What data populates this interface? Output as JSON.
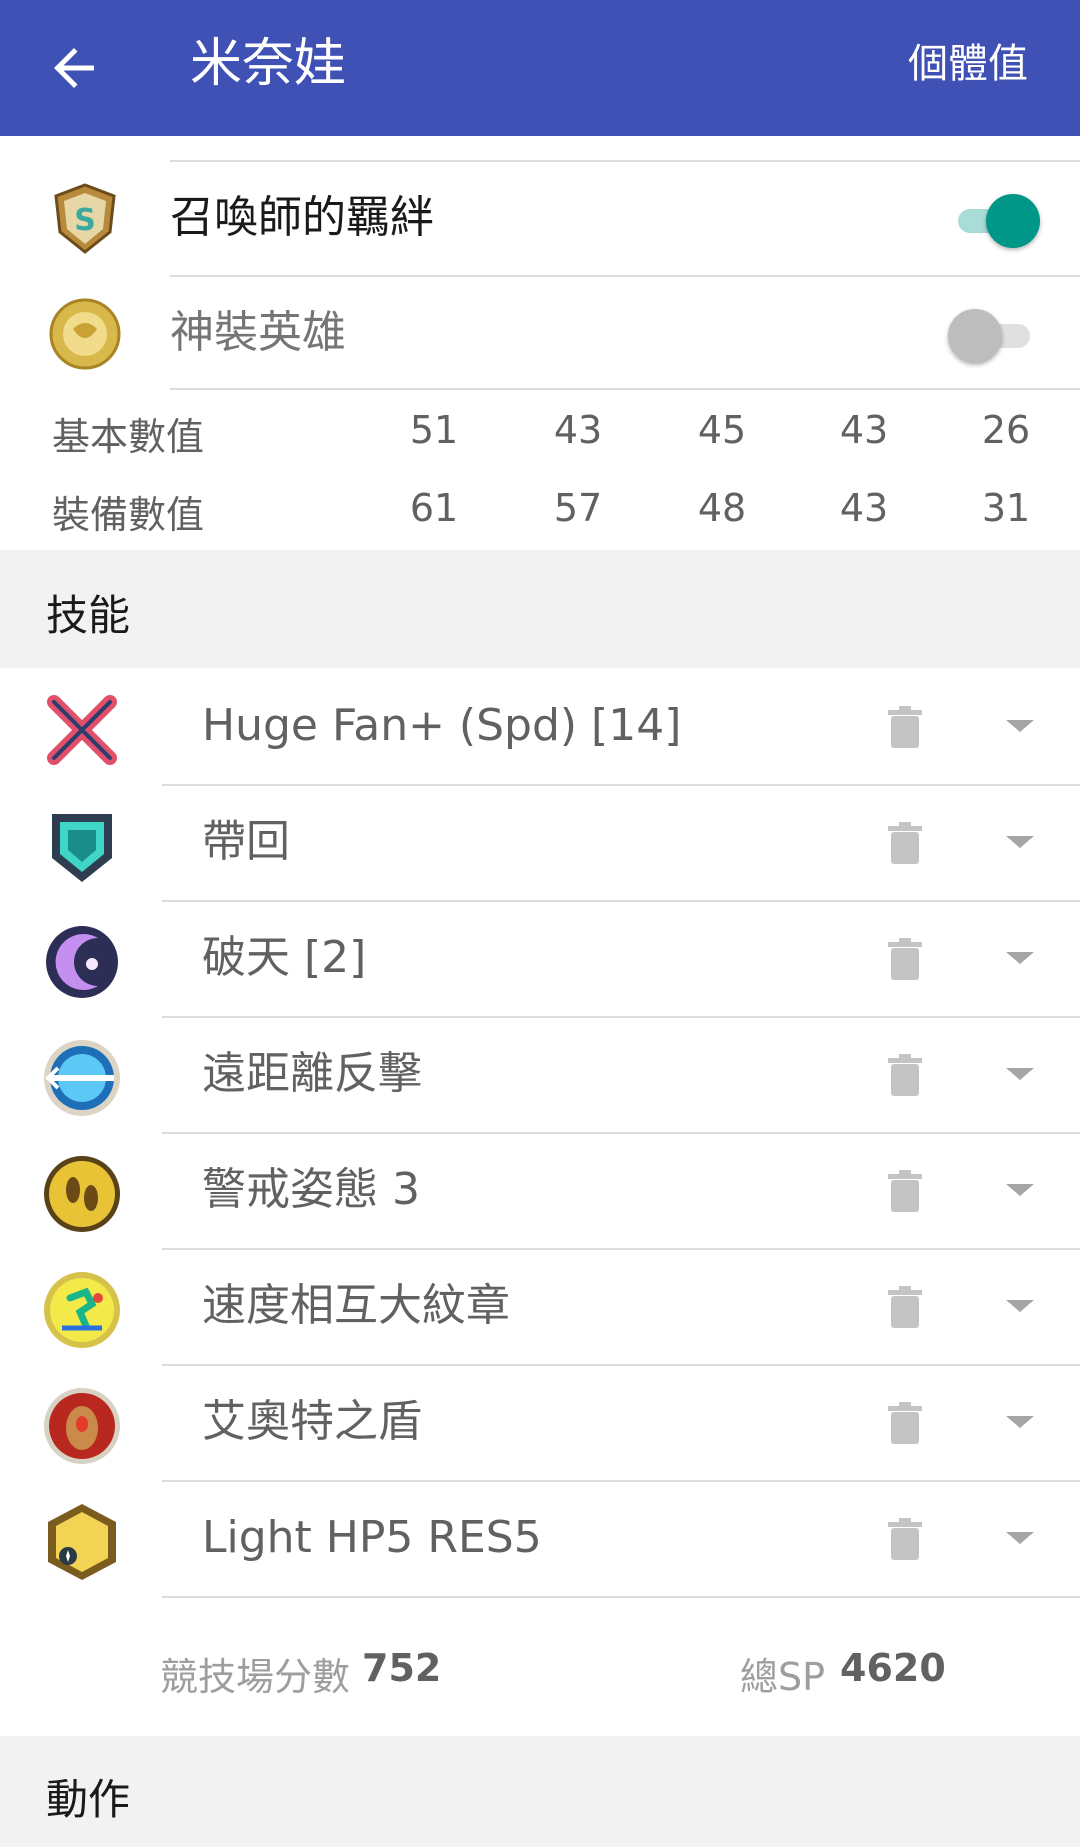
{
  "appbar": {
    "title": "米奈娃",
    "action_label": "個體值",
    "color": "#3f51b5"
  },
  "toggles": [
    {
      "label": "召喚師的羈絆",
      "state": "on",
      "icon": "summoner-support-s-badge-icon"
    },
    {
      "label": "神裝英雄",
      "state": "off",
      "icon": "resplendent-hero-wax-seal-icon"
    }
  ],
  "stats": {
    "base": {
      "label": "基本數值",
      "values": [
        "51",
        "43",
        "45",
        "43",
        "26"
      ]
    },
    "equipped": {
      "label": "裝備數值",
      "values": [
        "61",
        "57",
        "48",
        "43",
        "31"
      ]
    }
  },
  "skills_section": {
    "title": "技能"
  },
  "skills": [
    {
      "name": "Huge Fan+ (Spd)  [14]",
      "icon": "crossed-swords-weapon-icon"
    },
    {
      "name": "帶回",
      "icon": "assist-shield-icon"
    },
    {
      "name": "破天  [2]",
      "icon": "crescent-special-icon"
    },
    {
      "name": "遠距離反擊",
      "icon": "distant-counter-icon"
    },
    {
      "name": "警戒姿態 3",
      "icon": "footprints-vantage-icon"
    },
    {
      "name": "速度相互大紋章",
      "icon": "spd-tactic-runner-icon"
    },
    {
      "name": "艾奧特之盾",
      "icon": "iotes-shield-icon"
    },
    {
      "name": "Light HP5 RES5",
      "icon": "sacred-seal-light-icon"
    }
  ],
  "summary": {
    "arena_label": "競技場分數",
    "arena_value": "752",
    "sp_label": "總SP",
    "sp_value": "4620"
  },
  "actions_section": {
    "title": "動作"
  },
  "accent": "#009688"
}
